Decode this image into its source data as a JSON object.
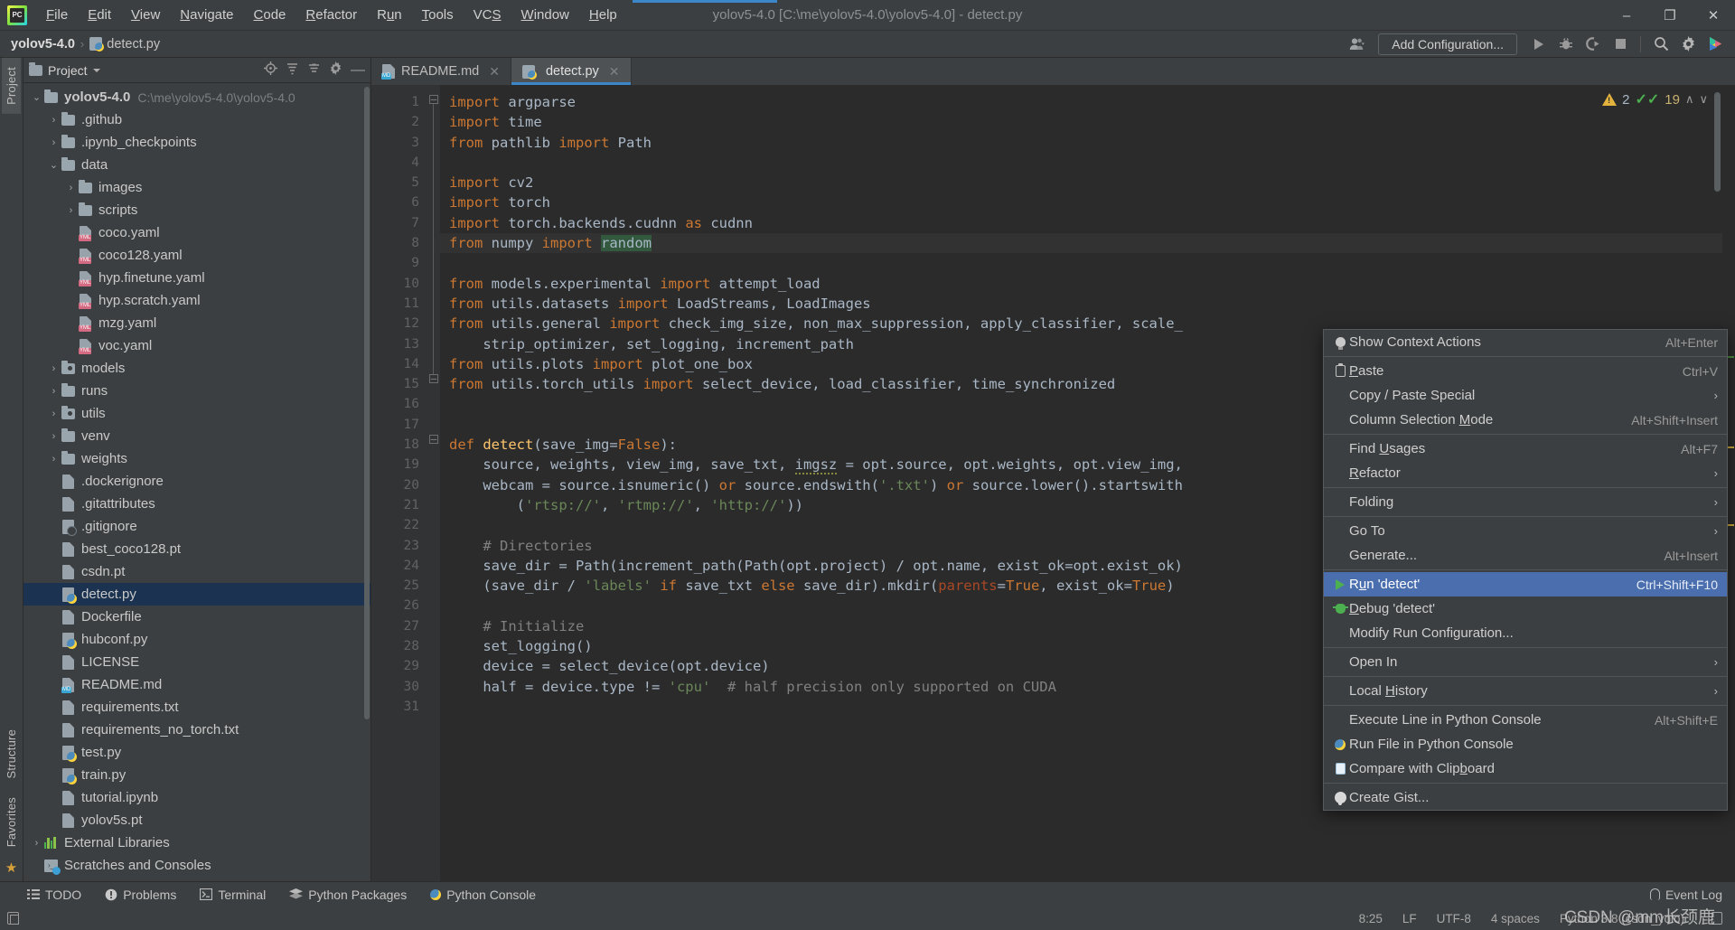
{
  "window": {
    "title": "yolov5-4.0 [C:\\me\\yolov5-4.0\\yolov5-4.0] - detect.py",
    "minimize": "–",
    "maximize": "❐",
    "close": "✕"
  },
  "menubar": {
    "logo_text": "PC",
    "items": [
      {
        "label": "File",
        "mnemonic": "F"
      },
      {
        "label": "Edit",
        "mnemonic": "E"
      },
      {
        "label": "View",
        "mnemonic": "V"
      },
      {
        "label": "Navigate",
        "mnemonic": "N"
      },
      {
        "label": "Code",
        "mnemonic": "C"
      },
      {
        "label": "Refactor",
        "mnemonic": "R"
      },
      {
        "label": "Run",
        "mnemonic": "u"
      },
      {
        "label": "Tools",
        "mnemonic": "T"
      },
      {
        "label": "VCS",
        "mnemonic": "S"
      },
      {
        "label": "Window",
        "mnemonic": "W"
      },
      {
        "label": "Help",
        "mnemonic": "H"
      }
    ]
  },
  "navbar": {
    "breadcrumb_project": "yolov5-4.0",
    "breadcrumb_separator": "›",
    "breadcrumb_file": "detect.py",
    "add_configuration": "Add Configuration...",
    "icons": [
      "user-avatar-icon",
      "run-icon",
      "debug-icon",
      "run-coverage-icon",
      "stop-icon",
      "search-icon",
      "settings-icon",
      "ai-assistant-icon"
    ]
  },
  "left_strip": {
    "project_tab": "Project",
    "structure_tab": "Structure",
    "favorites_tab": "Favorites"
  },
  "project_panel": {
    "title": "Project",
    "tree": [
      {
        "depth": 0,
        "arrow": "⌄",
        "icon": "folder",
        "label": "yolov5-4.0",
        "bold": true,
        "path": "C:\\me\\yolov5-4.0\\yolov5-4.0"
      },
      {
        "depth": 1,
        "arrow": "›",
        "icon": "folder",
        "label": ".github"
      },
      {
        "depth": 1,
        "arrow": "›",
        "icon": "folder",
        "label": ".ipynb_checkpoints"
      },
      {
        "depth": 1,
        "arrow": "⌄",
        "icon": "folder",
        "label": "data"
      },
      {
        "depth": 2,
        "arrow": "›",
        "icon": "folder",
        "label": "images"
      },
      {
        "depth": 2,
        "arrow": "›",
        "icon": "folder",
        "label": "scripts"
      },
      {
        "depth": 2,
        "arrow": "",
        "icon": "yaml",
        "label": "coco.yaml"
      },
      {
        "depth": 2,
        "arrow": "",
        "icon": "yaml",
        "label": "coco128.yaml"
      },
      {
        "depth": 2,
        "arrow": "",
        "icon": "yaml",
        "label": "hyp.finetune.yaml"
      },
      {
        "depth": 2,
        "arrow": "",
        "icon": "yaml",
        "label": "hyp.scratch.yaml"
      },
      {
        "depth": 2,
        "arrow": "",
        "icon": "yaml",
        "label": "mzg.yaml"
      },
      {
        "depth": 2,
        "arrow": "",
        "icon": "yaml",
        "label": "voc.yaml"
      },
      {
        "depth": 1,
        "arrow": "›",
        "icon": "folder-src",
        "label": "models"
      },
      {
        "depth": 1,
        "arrow": "›",
        "icon": "folder",
        "label": "runs"
      },
      {
        "depth": 1,
        "arrow": "›",
        "icon": "folder-src",
        "label": "utils"
      },
      {
        "depth": 1,
        "arrow": "›",
        "icon": "folder",
        "label": "venv"
      },
      {
        "depth": 1,
        "arrow": "›",
        "icon": "folder",
        "label": "weights"
      },
      {
        "depth": 1,
        "arrow": "",
        "icon": "file",
        "label": ".dockerignore"
      },
      {
        "depth": 1,
        "arrow": "",
        "icon": "file",
        "label": ".gitattributes"
      },
      {
        "depth": 1,
        "arrow": "",
        "icon": "gitignore",
        "label": ".gitignore"
      },
      {
        "depth": 1,
        "arrow": "",
        "icon": "file",
        "label": "best_coco128.pt"
      },
      {
        "depth": 1,
        "arrow": "",
        "icon": "file",
        "label": "csdn.pt"
      },
      {
        "depth": 1,
        "arrow": "",
        "icon": "python",
        "label": "detect.py",
        "selected": true
      },
      {
        "depth": 1,
        "arrow": "",
        "icon": "file",
        "label": "Dockerfile"
      },
      {
        "depth": 1,
        "arrow": "",
        "icon": "python",
        "label": "hubconf.py"
      },
      {
        "depth": 1,
        "arrow": "",
        "icon": "file",
        "label": "LICENSE"
      },
      {
        "depth": 1,
        "arrow": "",
        "icon": "md",
        "label": "README.md"
      },
      {
        "depth": 1,
        "arrow": "",
        "icon": "file",
        "label": "requirements.txt"
      },
      {
        "depth": 1,
        "arrow": "",
        "icon": "file",
        "label": "requirements_no_torch.txt"
      },
      {
        "depth": 1,
        "arrow": "",
        "icon": "python",
        "label": "test.py"
      },
      {
        "depth": 1,
        "arrow": "",
        "icon": "python",
        "label": "train.py"
      },
      {
        "depth": 1,
        "arrow": "",
        "icon": "file",
        "label": "tutorial.ipynb"
      },
      {
        "depth": 1,
        "arrow": "",
        "icon": "file",
        "label": "yolov5s.pt"
      },
      {
        "depth": 0,
        "arrow": "›",
        "icon": "library",
        "label": "External Libraries"
      },
      {
        "depth": 0,
        "arrow": "",
        "icon": "scratch",
        "label": "Scratches and Consoles"
      }
    ]
  },
  "editor": {
    "tabs": [
      {
        "label": "README.md",
        "icon": "markdown-icon",
        "active": false,
        "close": "✕"
      },
      {
        "label": "detect.py",
        "icon": "python-icon",
        "active": true,
        "close": "✕"
      }
    ],
    "inspection": {
      "warning_count": "2",
      "ok_count": "19",
      "up": "∧",
      "down": "∨"
    },
    "line_numbers": [
      "1",
      "2",
      "3",
      "4",
      "5",
      "6",
      "7",
      "8",
      "9",
      "10",
      "11",
      "12",
      "13",
      "14",
      "15",
      "16",
      "17",
      "18",
      "19",
      "20",
      "21",
      "22",
      "23",
      "24",
      "25",
      "26",
      "27",
      "28",
      "29",
      "30",
      "31"
    ],
    "code_lines": [
      "import argparse",
      "import time",
      "from pathlib import Path",
      "",
      "import cv2",
      "import torch",
      "import torch.backends.cudnn as cudnn",
      "from numpy import random",
      "",
      "from models.experimental import attempt_load",
      "from utils.datasets import LoadStreams, LoadImages",
      "from utils.general import check_img_size, non_max_suppression, apply_classifier, scale_",
      "    strip_optimizer, set_logging, increment_path",
      "from utils.plots import plot_one_box",
      "from utils.torch_utils import select_device, load_classifier, time_synchronized",
      "",
      "",
      "def detect(save_img=False):",
      "    source, weights, view_img, save_txt, imgsz = opt.source, opt.weights, opt.view_img,",
      "    webcam = source.isnumeric() or source.endswith('.txt') or source.lower().startswith",
      "        ('rtsp://', 'rtmp://', 'http://'))",
      "",
      "    # Directories",
      "    save_dir = Path(increment_path(Path(opt.project) / opt.name, exist_ok=opt.exist_ok)",
      "    (save_dir / 'labels' if save_txt else save_dir).mkdir(parents=True, exist_ok=True)",
      "",
      "    # Initialize",
      "    set_logging()",
      "    device = select_device(opt.device)",
      "    half = device.type != 'cpu'  # half precision only supported on CUDA",
      ""
    ]
  },
  "context_menu": {
    "items": [
      {
        "label": "Show Context Actions",
        "mnemonic": "",
        "shortcut": "Alt+Enter",
        "icon": "lightbulb-icon",
        "arrow": "",
        "highlight": false,
        "sep_after": true
      },
      {
        "label": "Paste",
        "mnemonic": "P",
        "shortcut": "Ctrl+V",
        "icon": "clipboard-icon",
        "arrow": "",
        "highlight": false
      },
      {
        "label": "Copy / Paste Special",
        "mnemonic": "",
        "shortcut": "",
        "icon": "",
        "arrow": "›",
        "highlight": false
      },
      {
        "label": "Column Selection Mode",
        "mnemonic": "M",
        "shortcut": "Alt+Shift+Insert",
        "icon": "",
        "arrow": "",
        "highlight": false,
        "sep_after": true
      },
      {
        "label": "Find Usages",
        "mnemonic": "U",
        "shortcut": "Alt+F7",
        "icon": "",
        "arrow": "",
        "highlight": false
      },
      {
        "label": "Refactor",
        "mnemonic": "R",
        "shortcut": "",
        "icon": "",
        "arrow": "›",
        "highlight": false,
        "sep_after": true
      },
      {
        "label": "Folding",
        "mnemonic": "",
        "shortcut": "",
        "icon": "",
        "arrow": "›",
        "highlight": false,
        "sep_after": true
      },
      {
        "label": "Go To",
        "mnemonic": "",
        "shortcut": "",
        "icon": "",
        "arrow": "›",
        "highlight": false
      },
      {
        "label": "Generate...",
        "mnemonic": "",
        "shortcut": "Alt+Insert",
        "icon": "",
        "arrow": "",
        "highlight": false,
        "sep_after": true
      },
      {
        "label": "Run 'detect'",
        "mnemonic": "u",
        "shortcut": "Ctrl+Shift+F10",
        "icon": "run-green-icon",
        "arrow": "",
        "highlight": true
      },
      {
        "label": "Debug 'detect'",
        "mnemonic": "D",
        "shortcut": "",
        "icon": "debug-green-icon",
        "arrow": "",
        "highlight": false
      },
      {
        "label": "Modify Run Configuration...",
        "mnemonic": "",
        "shortcut": "",
        "icon": "",
        "arrow": "",
        "highlight": false,
        "sep_after": true
      },
      {
        "label": "Open In",
        "mnemonic": "",
        "shortcut": "",
        "icon": "",
        "arrow": "›",
        "highlight": false,
        "sep_after": true
      },
      {
        "label": "Local History",
        "mnemonic": "H",
        "shortcut": "",
        "icon": "",
        "arrow": "›",
        "highlight": false,
        "sep_after": true
      },
      {
        "label": "Execute Line in Python Console",
        "mnemonic": "",
        "shortcut": "Alt+Shift+E",
        "icon": "",
        "arrow": "",
        "highlight": false
      },
      {
        "label": "Run File in Python Console",
        "mnemonic": "",
        "shortcut": "",
        "icon": "python-icon",
        "arrow": "",
        "highlight": false
      },
      {
        "label": "Compare with Clipboard",
        "mnemonic": "b",
        "shortcut": "",
        "icon": "compare-icon",
        "arrow": "",
        "highlight": false,
        "sep_after": true
      },
      {
        "label": "Create Gist...",
        "mnemonic": "",
        "shortcut": "",
        "icon": "github-icon",
        "arrow": "",
        "highlight": false
      }
    ]
  },
  "tool_window_bar": {
    "items": [
      {
        "label": "TODO",
        "icon": "todo-icon"
      },
      {
        "label": "Problems",
        "icon": "problems-icon"
      },
      {
        "label": "Terminal",
        "icon": "terminal-icon"
      },
      {
        "label": "Python Packages",
        "icon": "packages-icon"
      },
      {
        "label": "Python Console",
        "icon": "python-console-icon"
      }
    ],
    "event_log": "Event Log"
  },
  "status_bar": {
    "caret_position": "8:25",
    "line_separator": "LF",
    "encoding": "UTF-8",
    "indent": "4 spaces",
    "interpreter": "Python 3.8 (csdn_yolo)",
    "watermark": "CSDN @mm长颈鹿"
  },
  "colors": {
    "accent_blue": "#3c87c9",
    "selection_blue": "#4b6eaf",
    "tree_selection": "#1b3350",
    "editor_bg": "#2b2b2b",
    "panel_bg": "#3c3f41",
    "keyword_orange": "#cc7832",
    "string_green": "#6a8759",
    "function_yellow": "#ffc66d",
    "comment_gray": "#808080",
    "number_blue": "#6897bb"
  }
}
